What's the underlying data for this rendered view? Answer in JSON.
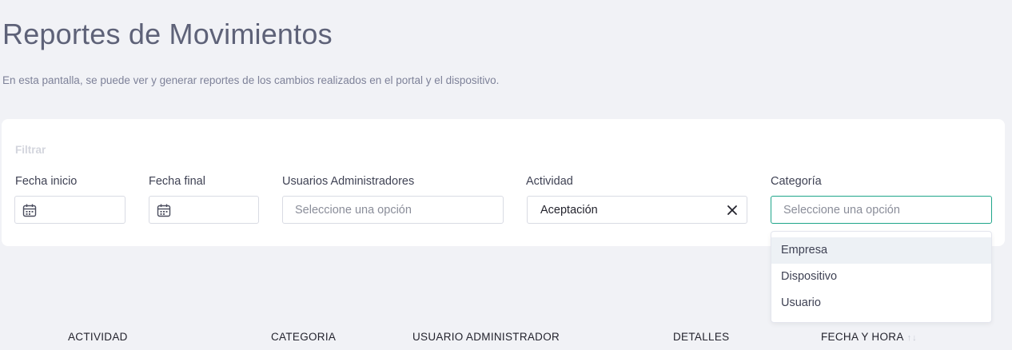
{
  "page": {
    "title": "Reportes de Movimientos",
    "description": "En esta pantalla, se puede ver y generar reportes de los cambios realizados en el portal y el dispositivo."
  },
  "filters": {
    "title": "Filtrar",
    "fecha_inicio": {
      "label": "Fecha inicio",
      "icon": "calendar-icon",
      "value": ""
    },
    "fecha_final": {
      "label": "Fecha final",
      "icon": "calendar-icon",
      "value": ""
    },
    "usuarios": {
      "label": "Usuarios Administradores",
      "placeholder": "Seleccione una opción"
    },
    "actividad": {
      "label": "Actividad",
      "value": "Aceptación",
      "clear_icon": "close-icon"
    },
    "categoria": {
      "label": "Categoría",
      "placeholder": "Seleccione una opción",
      "accent": "#1fa58a"
    }
  },
  "categoria_options": [
    "Empresa",
    "Dispositivo",
    "Usuario"
  ],
  "table": {
    "columns": [
      "ACTIVIDAD",
      "CATEGORIA",
      "USUARIO ADMINISTRADOR",
      "DETALLES",
      "FECHA Y HORA"
    ],
    "sort_indicator": "↑↓"
  }
}
